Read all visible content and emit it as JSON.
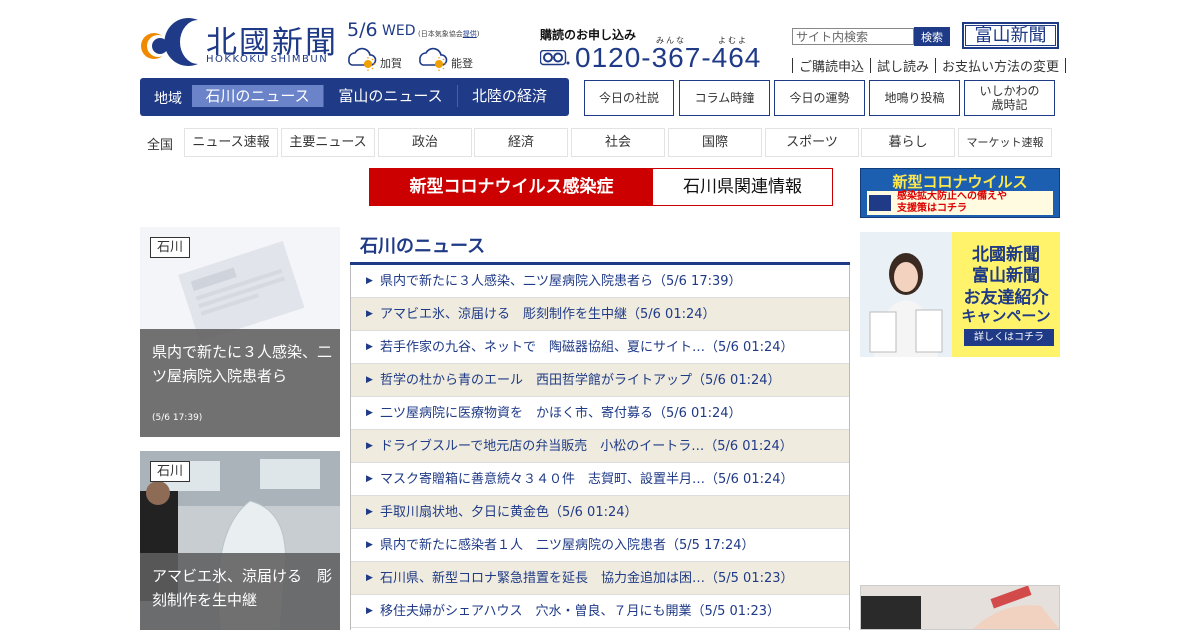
{
  "header": {
    "logo_name": "北國新聞",
    "logo_roman": "HOKKOKU SHIMBUN",
    "date": "5/6",
    "weekday": "WED",
    "weather_source_prefix": "(日本気象協会",
    "weather_source_link": "提供",
    "weather_source_suffix": ")",
    "weather": [
      {
        "region": "加賀",
        "icon": "cloudy-sunny-icon"
      },
      {
        "region": "能登",
        "icon": "cloudy-sunny-icon"
      }
    ],
    "subscription_title": "購読のお申し込み",
    "ruby_minna": "みんな",
    "ruby_yomu": "よむよ",
    "phone": "0120-367-464",
    "search_placeholder": "サイト内検索",
    "search_button": "検索",
    "toyama_logo": "富山新聞",
    "links": [
      "ご購読申込",
      "試し読み",
      "お支払い方法の変更"
    ]
  },
  "region_nav": {
    "label": "地域",
    "tabs": [
      "石川のニュース",
      "富山のニュース",
      "北陸の経済"
    ],
    "active_index": 0
  },
  "utility_buttons": [
    "今日の社説",
    "コラム時鐘",
    "今日の運勢",
    "地鳴り投稿",
    "いしかわの\n歳時記"
  ],
  "categories": {
    "lead": "全国",
    "items": [
      "ニュース速報",
      "主要ニュース",
      "政治",
      "経済",
      "社会",
      "国際",
      "スポーツ",
      "暮らし",
      "マーケット速報"
    ]
  },
  "corona_banner": {
    "left": "新型コロナウイルス感染症",
    "right": "石川県関連情報"
  },
  "ads": {
    "corona_ad_top": "新型コロナウイルス",
    "corona_ad_line1": "感染拡大防止への備えや",
    "corona_ad_line2": "支援策はコチラ",
    "corona_ad_gov": "政府広報",
    "friend_line1": "北國新聞",
    "friend_line2": "富山新聞",
    "friend_line3": "お友達紹介",
    "friend_line4": "キャンペーン",
    "friend_button": "詳しくはコチラ"
  },
  "feature_cards": [
    {
      "badge": "石川",
      "title": "県内で新たに３人感染、二ツ屋病院入院患者ら",
      "time": "(5/6 17:39)"
    },
    {
      "badge": "石川",
      "title": "アマビエ氷、涼届ける　彫刻制作を生中継"
    }
  ],
  "news": {
    "heading": "石川のニュース",
    "items": [
      "県内で新たに３人感染、二ツ屋病院入院患者ら（5/6 17:39）",
      "アマビエ氷、涼届ける　彫刻制作を生中継（5/6 01:24）",
      "若手作家の九谷、ネットで　陶磁器協組、夏にサイト…（5/6 01:24）",
      "哲学の杜から青のエール　西田哲学館がライトアップ（5/6 01:24）",
      "二ツ屋病院に医療物資を　かほく市、寄付募る（5/6 01:24）",
      "ドライブスルーで地元店の弁当販売　小松のイートラ…（5/6 01:24）",
      "マスク寄贈箱に善意続々３４０件　志賀町、設置半月…（5/6 01:24）",
      "手取川扇状地、夕日に黄金色（5/6 01:24）",
      "県内で新たに感染者１人　二ツ屋病院の入院患者（5/5 17:24）",
      "石川県、新型コロナ緊急措置を延長　協力金追加は困…（5/5 01:23）",
      "移住夫婦がシェアハウス　穴水・曽良、７月にも開業（5/5 01:23）"
    ]
  },
  "colors": {
    "brand_navy": "#1f3a86",
    "active_tab": "#6b84c9",
    "corona_red": "#cc0000",
    "alt_row": "#efecdf"
  }
}
